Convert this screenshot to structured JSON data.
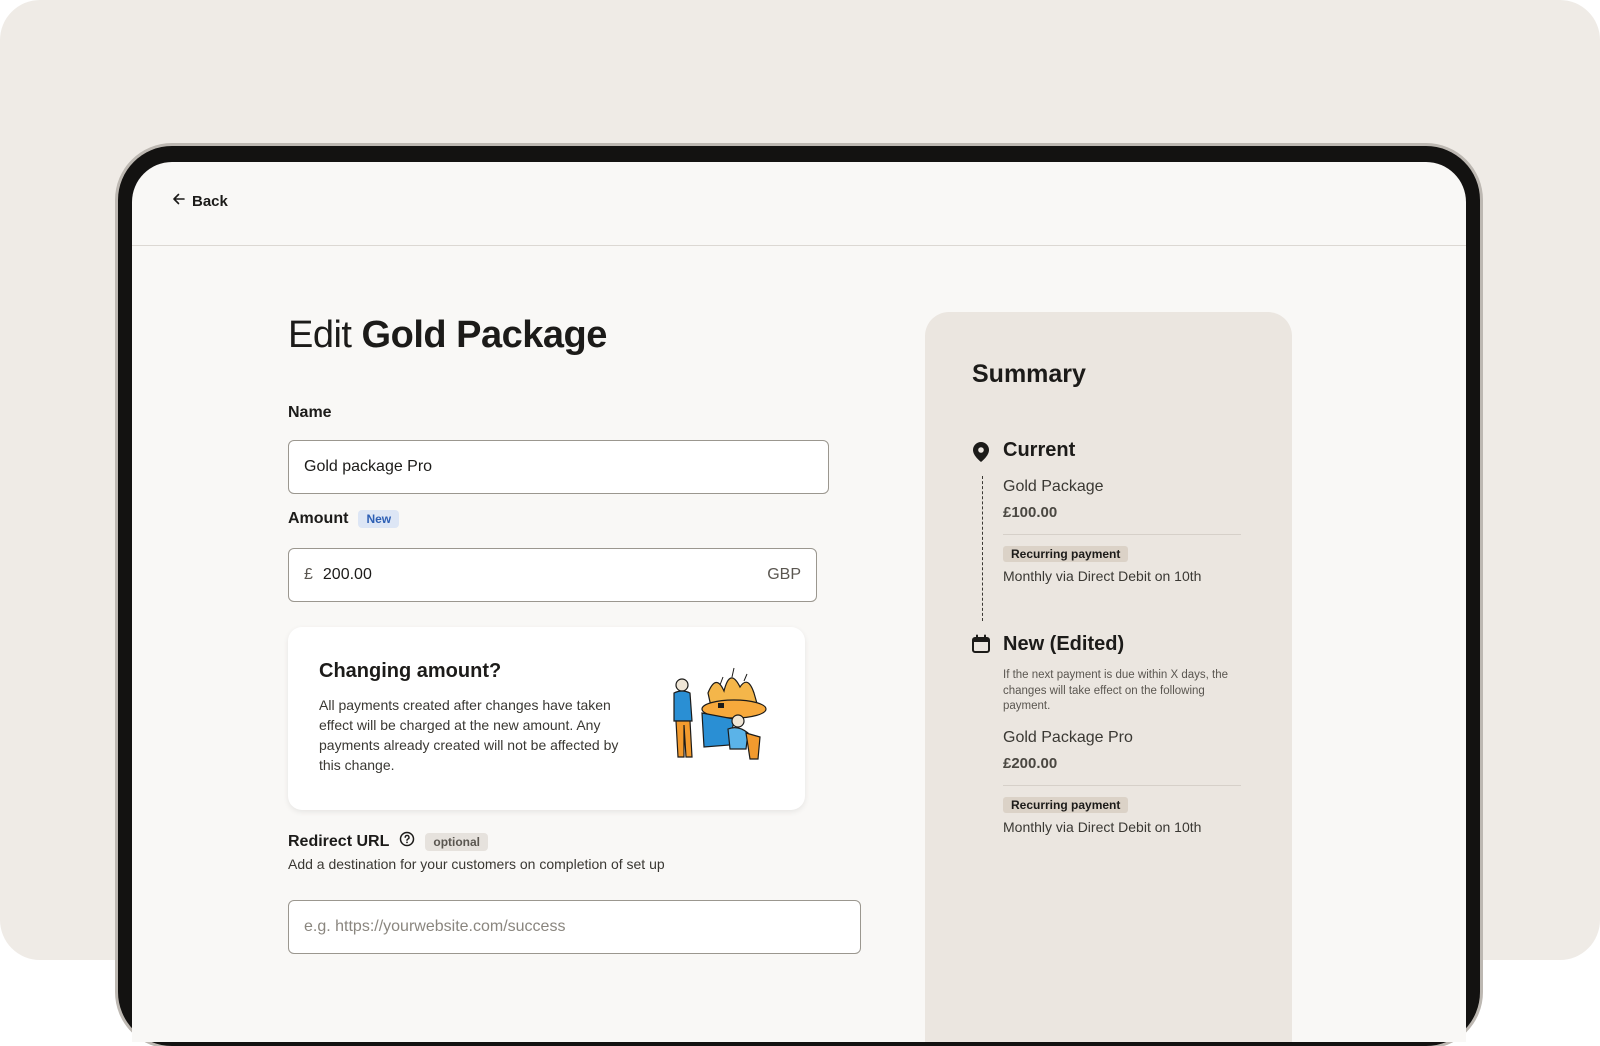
{
  "nav": {
    "back_label": "Back"
  },
  "page": {
    "title_prefix": "Edit",
    "title_bold": "Gold Package"
  },
  "form": {
    "name_label": "Name",
    "name_value": "Gold package Pro",
    "amount_label": "Amount",
    "amount_badge": "New",
    "currency_symbol": "£",
    "amount_value": "200.00",
    "currency_code": "GBP",
    "redirect_label": "Redirect URL",
    "redirect_badge": "optional",
    "redirect_helper": "Add a destination for your customers on completion of set up",
    "redirect_placeholder": "e.g. https://yourwebsite.com/success"
  },
  "info_card": {
    "heading": "Changing amount?",
    "body": "All payments created after changes have taken effect will be charged at the new amount. Any payments already created will not be affected by this change."
  },
  "summary": {
    "title": "Summary",
    "current": {
      "heading": "Current",
      "name": "Gold Package",
      "price": "£100.00",
      "badge": "Recurring payment",
      "schedule": "Monthly via Direct Debit on 10th"
    },
    "new": {
      "heading": "New (Edited)",
      "note": "If the next payment is due within X days, the changes will take effect on the following payment.",
      "name": "Gold Package Pro",
      "price": "£200.00",
      "badge": "Recurring payment",
      "schedule": "Monthly via Direct Debit on 10th"
    }
  },
  "icons": {
    "back": "arrow-left-icon",
    "help": "question-circle-icon",
    "current": "location-pin-icon",
    "new": "calendar-icon"
  }
}
